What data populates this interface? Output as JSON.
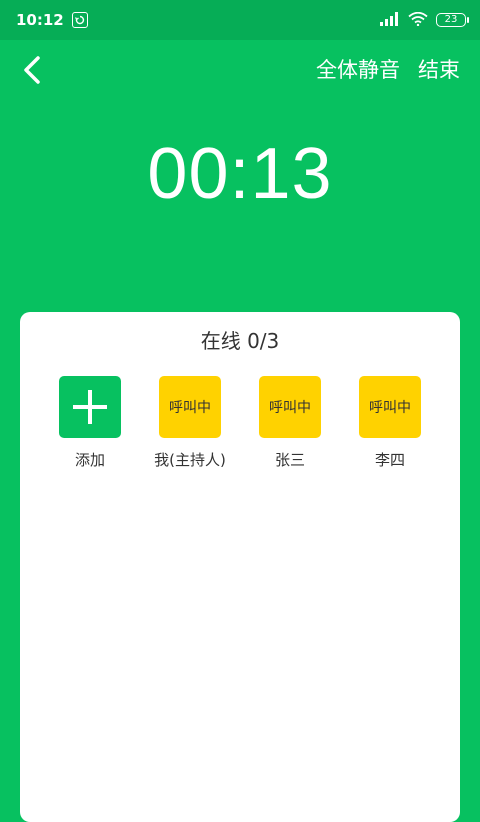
{
  "status_bar": {
    "time": "10:12",
    "battery": "23"
  },
  "header": {
    "mute_all": "全体静音",
    "end": "结束"
  },
  "timer": "00:13",
  "online": {
    "title": "在线 0/3"
  },
  "members": [
    {
      "name": "添加",
      "type": "add"
    },
    {
      "name": "我(主持人)",
      "type": "calling",
      "status": "呼叫中"
    },
    {
      "name": "张三",
      "type": "calling",
      "status": "呼叫中"
    },
    {
      "name": "李四",
      "type": "calling",
      "status": "呼叫中"
    }
  ],
  "colors": {
    "primary_green": "#07c160",
    "status_bar_green": "#06ad56",
    "calling_yellow": "#ffd200"
  }
}
